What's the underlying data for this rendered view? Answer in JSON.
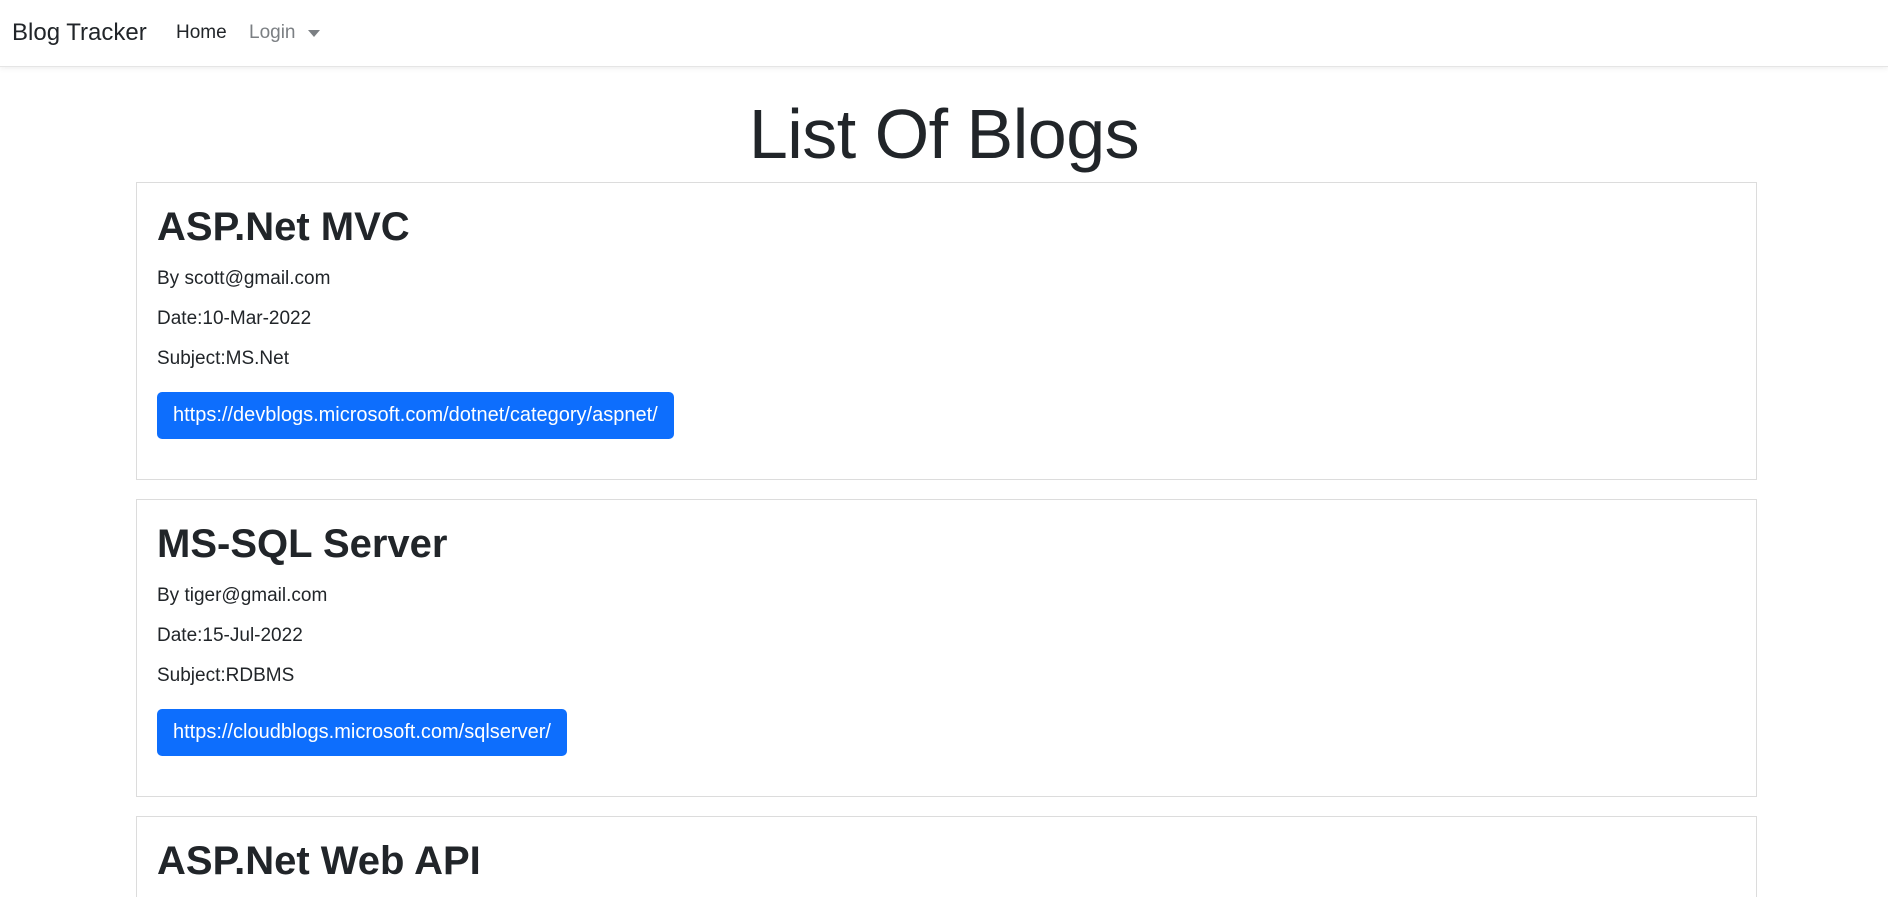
{
  "navbar": {
    "brand": "Blog Tracker",
    "home": "Home",
    "login": "Login"
  },
  "page": {
    "title": "List Of Blogs"
  },
  "blogs": [
    {
      "title": "ASP.Net MVC",
      "author": "By scott@gmail.com",
      "date": "Date:10-Mar-2022",
      "subject": "Subject:MS.Net",
      "url": "https://devblogs.microsoft.com/dotnet/category/aspnet/"
    },
    {
      "title": "MS-SQL Server",
      "author": "By tiger@gmail.com",
      "date": "Date:15-Jul-2022",
      "subject": "Subject:RDBMS",
      "url": "https://cloudblogs.microsoft.com/sqlserver/"
    },
    {
      "title": "ASP.Net Web API"
    }
  ],
  "colors": {
    "primary": "#0d6efd",
    "text": "#212529",
    "muted": "#7b7f83"
  }
}
